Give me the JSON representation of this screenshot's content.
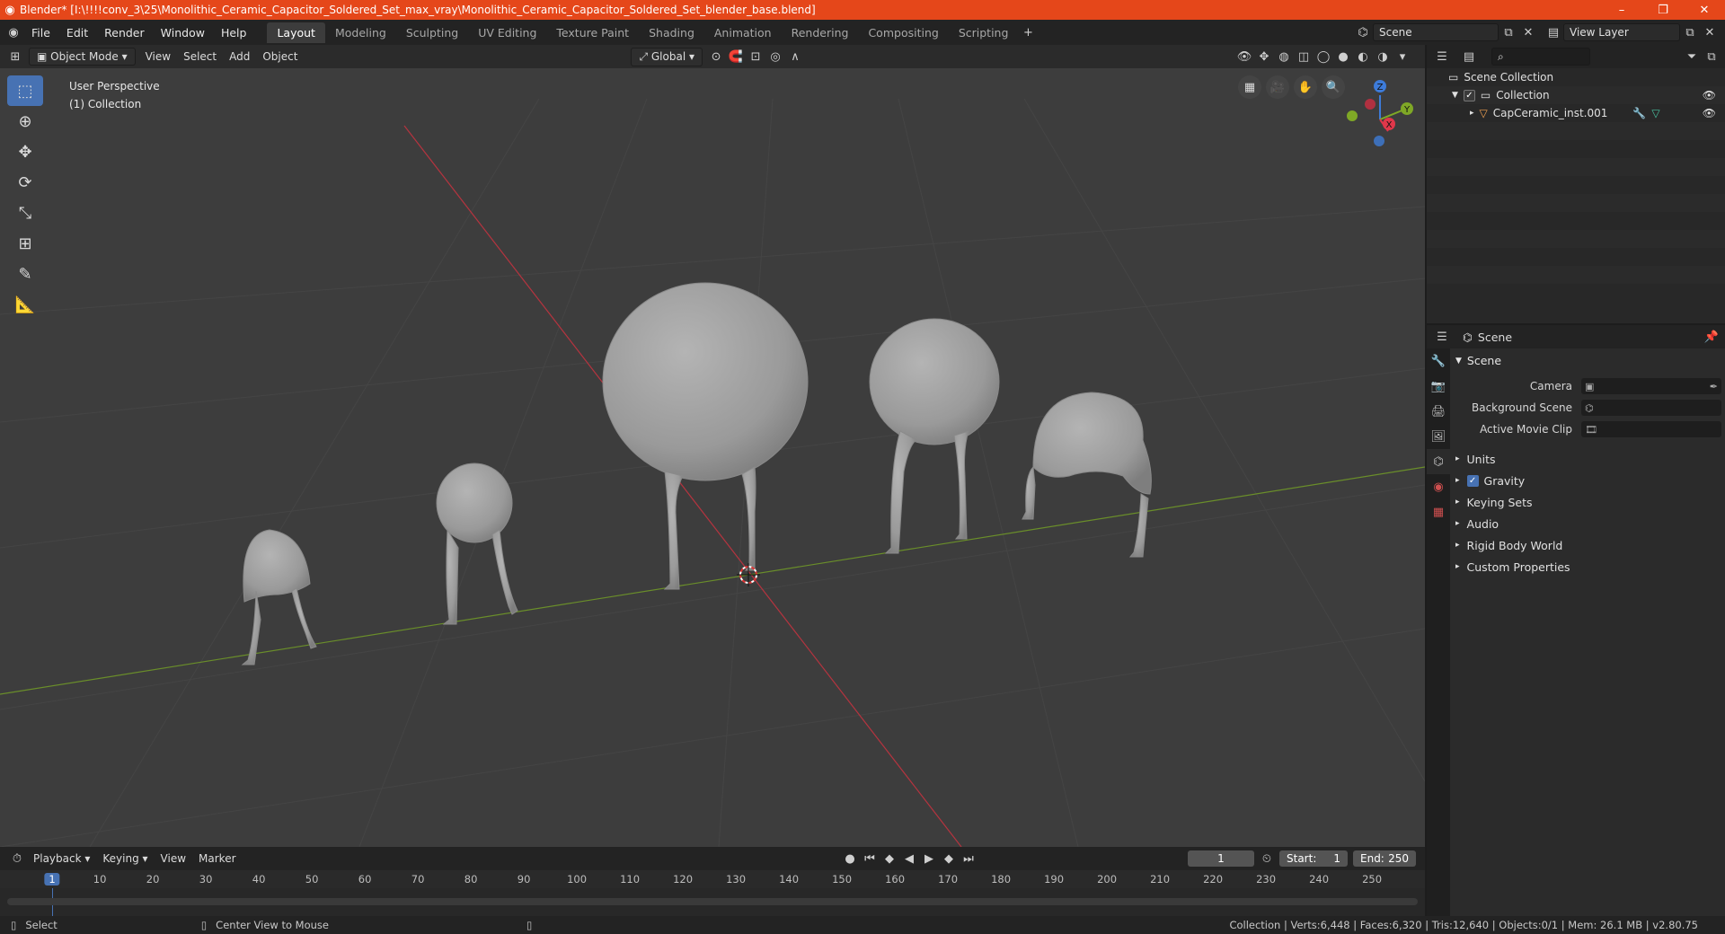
{
  "window": {
    "title": "Blender* [I:\\!!!!conv_3\\25\\Monolithic_Ceramic_Capacitor_Soldered_Set_max_vray\\Monolithic_Ceramic_Capacitor_Soldered_Set_blender_base.blend]",
    "min": "–",
    "max": "❐",
    "close": "✕"
  },
  "menu": [
    "File",
    "Edit",
    "Render",
    "Window",
    "Help"
  ],
  "workspaces": [
    "Layout",
    "Modeling",
    "Sculpting",
    "UV Editing",
    "Texture Paint",
    "Shading",
    "Animation",
    "Rendering",
    "Compositing",
    "Scripting"
  ],
  "active_workspace": "Layout",
  "scene_field": "Scene",
  "view_layer_field": "View Layer",
  "viewport": {
    "mode": "Object Mode",
    "menus": [
      "View",
      "Select",
      "Add",
      "Object"
    ],
    "orientation": "Global",
    "info_line1": "User Perspective",
    "info_line2": "(1) Collection",
    "gizmo": {
      "x": "X",
      "y": "Y",
      "z": "Z"
    }
  },
  "outliner": {
    "root": "Scene Collection",
    "collection": "Collection",
    "object": "CapCeramic_inst.001"
  },
  "properties": {
    "header": "Scene",
    "panel": "Scene",
    "rows": [
      {
        "label": "Camera",
        "value": ""
      },
      {
        "label": "Background Scene",
        "value": ""
      },
      {
        "label": "Active Movie Clip",
        "value": ""
      }
    ],
    "subpanels": [
      "Units",
      "Gravity",
      "Keying Sets",
      "Audio",
      "Rigid Body World",
      "Custom Properties"
    ],
    "gravity_checked": true
  },
  "timeline": {
    "menus": [
      "Playback",
      "Keying",
      "View",
      "Marker"
    ],
    "current_frame": "1",
    "start_label": "Start:",
    "start": "1",
    "end_label": "End:",
    "end": "250",
    "ticks": [
      "1",
      "10",
      "20",
      "30",
      "40",
      "50",
      "60",
      "70",
      "80",
      "90",
      "100",
      "110",
      "120",
      "130",
      "140",
      "150",
      "160",
      "170",
      "180",
      "190",
      "200",
      "210",
      "220",
      "230",
      "240",
      "250"
    ]
  },
  "status": {
    "select": "Select",
    "center_view": "Center View to Mouse",
    "stats": "Collection | Verts:6,448 | Faces:6,320 | Tris:12,640 | Objects:0/1 | Mem: 26.1 MB | v2.80.75"
  }
}
